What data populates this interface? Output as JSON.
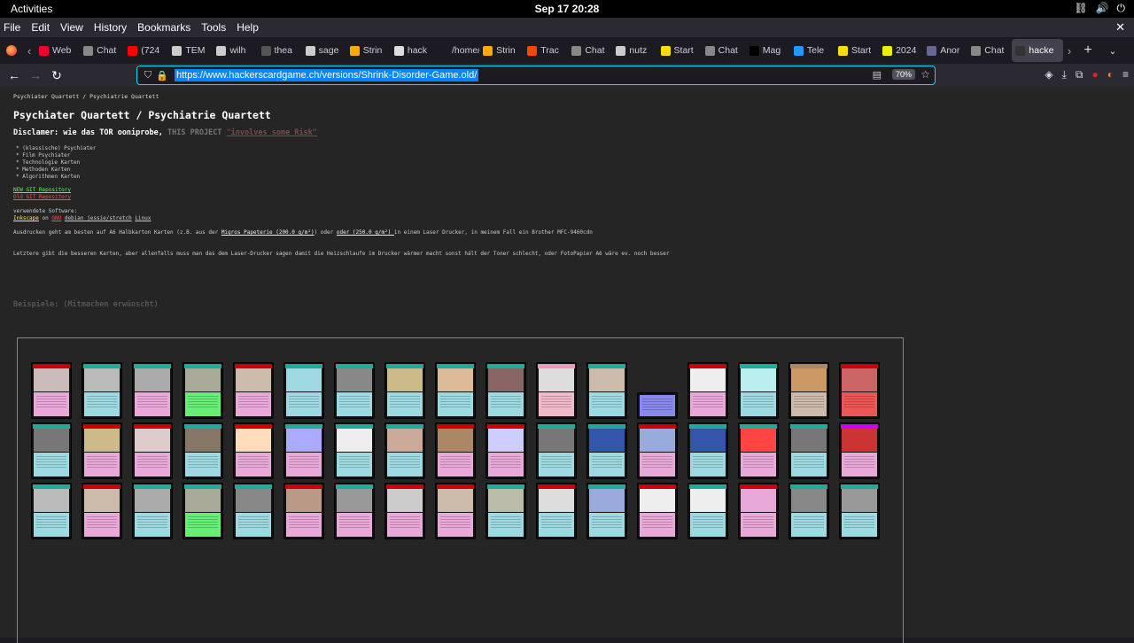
{
  "gnome": {
    "activities": "Activities",
    "clock": "Sep 17  20:28"
  },
  "menu": {
    "items": [
      "File",
      "Edit",
      "View",
      "History",
      "Bookmarks",
      "Tools",
      "Help"
    ]
  },
  "tabs": [
    {
      "label": "Web",
      "color": "#e03"
    },
    {
      "label": "Chat",
      "color": "#888"
    },
    {
      "label": "(724",
      "color": "#f00"
    },
    {
      "label": "TEM",
      "color": "#ccc"
    },
    {
      "label": "wilh",
      "color": "#ccc"
    },
    {
      "label": "thea",
      "color": "#555"
    },
    {
      "label": "sage",
      "color": "#ccc"
    },
    {
      "label": "Strin",
      "color": "#fa0"
    },
    {
      "label": "hack",
      "color": "#ddd"
    },
    {
      "label": "/home/r",
      "color": "transparent"
    },
    {
      "label": "Strin",
      "color": "#fa0"
    },
    {
      "label": "Trac",
      "color": "#f40"
    },
    {
      "label": "Chat",
      "color": "#888"
    },
    {
      "label": "nutz",
      "color": "#ccc"
    },
    {
      "label": "Start",
      "color": "#fd0"
    },
    {
      "label": "Chat",
      "color": "#888"
    },
    {
      "label": "Mag",
      "color": "#000"
    },
    {
      "label": "Tele",
      "color": "#29f"
    },
    {
      "label": "Start",
      "color": "#fd0"
    },
    {
      "label": "2024",
      "color": "#ee0"
    },
    {
      "label": "Anor",
      "color": "#669"
    },
    {
      "label": "Chat",
      "color": "#888"
    },
    {
      "label": "hacke",
      "color": "#333",
      "active": true
    }
  ],
  "url": "https://www.hackerscardgame.ch/versions/Shrink-Disorder-Game.old/",
  "zoom": "70%",
  "page": {
    "breadcrumb": "Psychiater Quartett / Psychiatrie Quartett",
    "title": "Psychiater Quartett / Psychiatrie Quartett",
    "disclaimer": "Disclamer: wie das TOR ooniprobe,",
    "disclaimer_project": "THIS PROJECT",
    "disclaimer_risk": "\"involves some Risk\"",
    "list": [
      "* (klassische) Psychiater",
      "* Film Psychiater",
      "* Technologie Karten",
      "* Methoden Karten",
      "* Algorithmen Karten"
    ],
    "link_new_git": "NEW GIT Repository",
    "link_old_git": "Old GIT Repository",
    "software_label": "verwendete Software:",
    "sw_inkscape": "Inkscape",
    "sw_on": " on ",
    "sw_gnu": "GNU",
    "sw_debian": "debian jessie/stretch",
    "sw_linux": "Linux",
    "print_1": "Ausdrucken geht am besten auf A6 Halbkarton Karten (z.B. aus der ",
    "print_migros": "Migros Papeterie (200.0 g/m²)",
    "print_2": ") oder ",
    "print_oder": "oder (250.0 g/m²) ",
    "print_3": "in einem Laser Drucker, in meinem Fall ein Brother MFC-9460cdn",
    "note": "Letztere gibt die besseren Karten, aber allenfalls muss man das dem Laser-Drucker sagen damit die Heizschlaufe im Drucker wärmer macht sonst hält der Toner schlecht, oder FotoPapier A6 wäre ev. noch besser",
    "examples": "Beispiele: (Mitmachen erwünscht)"
  },
  "cards": [
    {
      "h": "#c00",
      "b": "#e8a8d8",
      "i": "#cbb"
    },
    {
      "h": "#2a9",
      "b": "#9ed8e0",
      "i": "#bbb"
    },
    {
      "h": "#2a9",
      "b": "#e8a8d8",
      "i": "#aaa"
    },
    {
      "h": "#2a9",
      "b": "#66ee77",
      "i": "#aa9"
    },
    {
      "h": "#c00",
      "b": "#e8a8d8",
      "i": "#cba"
    },
    {
      "h": "#2a9",
      "b": "#9ed8e0",
      "i": "#9ed8e0"
    },
    {
      "h": "#2a9",
      "b": "#9ed8e0",
      "i": "#888"
    },
    {
      "h": "#2a9",
      "b": "#9ed8e0",
      "i": "#cb8"
    },
    {
      "h": "#2a9",
      "b": "#9ed8e0",
      "i": "#db9"
    },
    {
      "h": "#2a9",
      "b": "#9ed8e0",
      "i": "#866"
    },
    {
      "h": "#e9b",
      "b": "#f0b8c8",
      "i": "#ddd"
    },
    {
      "h": "#2a9",
      "b": "#9ed8e0",
      "i": "#cba"
    },
    {
      "h": "none",
      "b": "#8888ee",
      "i": "#8888ee"
    },
    {
      "h": "#c00",
      "b": "#e8a8d8",
      "i": "#eee"
    },
    {
      "h": "#2a9",
      "b": "#9ed8e0",
      "i": "#bee"
    },
    {
      "h": "#a86",
      "b": "#cba",
      "i": "#c96"
    },
    {
      "h": "#c00",
      "b": "#ee5555",
      "i": "#c66"
    },
    {
      "h": "#2a9",
      "b": "#9ed8e0",
      "i": "#777"
    },
    {
      "h": "#c00",
      "b": "#e8a8d8",
      "i": "#cb8"
    },
    {
      "h": "#c00",
      "b": "#e8a8d8",
      "i": "#dcc"
    },
    {
      "h": "#2a9",
      "b": "#9ed8e0",
      "i": "#876"
    },
    {
      "h": "#c00",
      "b": "#e8a8d8",
      "i": "#fdb"
    },
    {
      "h": "#2a9",
      "b": "#e8a8d8",
      "i": "#aaf"
    },
    {
      "h": "#2a9",
      "b": "#9ed8e0",
      "i": "#eee"
    },
    {
      "h": "#2a9",
      "b": "#9ed8e0",
      "i": "#ca9"
    },
    {
      "h": "#c00",
      "b": "#e8a8d8",
      "i": "#a86"
    },
    {
      "h": "#c00",
      "b": "#e8a8d8",
      "i": "#ccf"
    },
    {
      "h": "#2a9",
      "b": "#9ed8e0",
      "i": "#777"
    },
    {
      "h": "#2a9",
      "b": "#9ed8e0",
      "i": "#35a"
    },
    {
      "h": "#c00",
      "b": "#e8a8d8",
      "i": "#9ad"
    },
    {
      "h": "#2a9",
      "b": "#9ed8e0",
      "i": "#35a"
    },
    {
      "h": "#2a9",
      "b": "#e8a8d8",
      "i": "#f44"
    },
    {
      "h": "#2a9",
      "b": "#9ed8e0",
      "i": "#777"
    },
    {
      "h": "#c0f",
      "b": "#e8a8d8",
      "i": "#c33"
    },
    {
      "h": "#2a9",
      "b": "#9ed8e0",
      "i": "#bbb"
    },
    {
      "h": "#c00",
      "b": "#e8a8d8",
      "i": "#cba"
    },
    {
      "h": "#2a9",
      "b": "#9ed8e0",
      "i": "#aaa"
    },
    {
      "h": "#2a9",
      "b": "#66ee77",
      "i": "#aa9"
    },
    {
      "h": "#2a9",
      "b": "#9ed8e0",
      "i": "#888"
    },
    {
      "h": "#c00",
      "b": "#e8a8d8",
      "i": "#b98"
    },
    {
      "h": "#2a9",
      "b": "#e8a8d8",
      "i": "#999"
    },
    {
      "h": "#c00",
      "b": "#e8a8d8",
      "i": "#ccc"
    },
    {
      "h": "#c00",
      "b": "#e8a8d8",
      "i": "#cba"
    },
    {
      "h": "#2a9",
      "b": "#9ed8e0",
      "i": "#bba"
    },
    {
      "h": "#c00",
      "b": "#9ed8e0",
      "i": "#ddd"
    },
    {
      "h": "#2a9",
      "b": "#9ed8e0",
      "i": "#9ad"
    },
    {
      "h": "#c00",
      "b": "#e8a8d8",
      "i": "#eee"
    },
    {
      "h": "#2a9",
      "b": "#9ed8e0",
      "i": "#eee"
    },
    {
      "h": "#c00",
      "b": "#e8a8d8",
      "i": "#e8a8d8"
    },
    {
      "h": "#2a9",
      "b": "#9ed8e0",
      "i": "#888"
    },
    {
      "h": "#2a9",
      "b": "#9ed8e0",
      "i": "#999"
    }
  ]
}
